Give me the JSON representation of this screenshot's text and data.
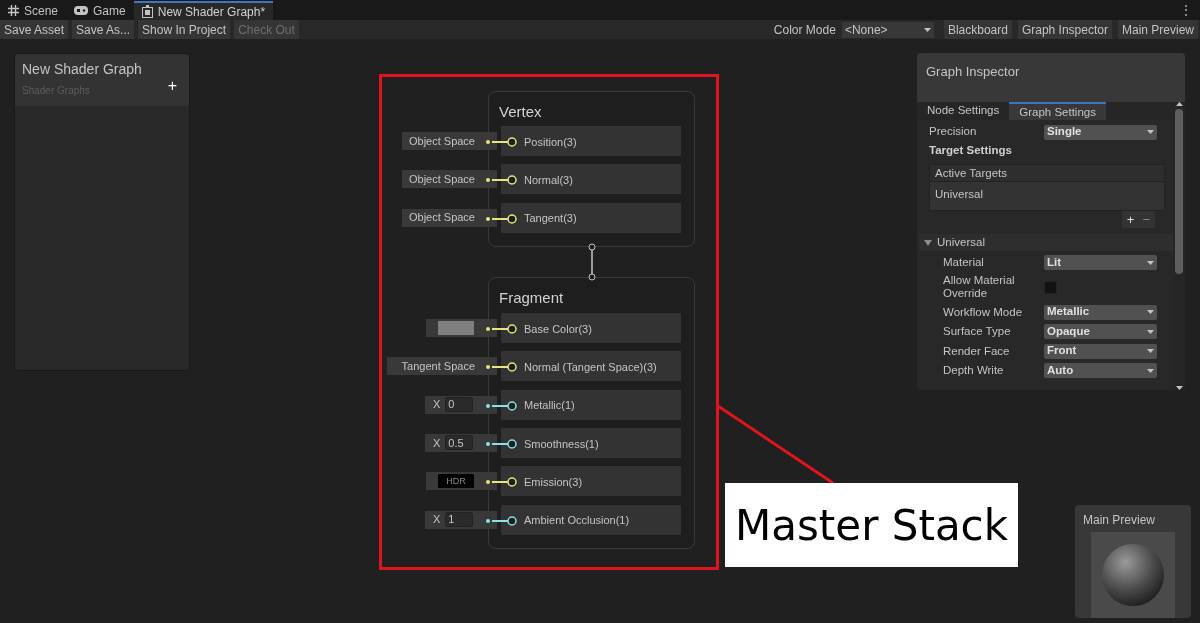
{
  "tabs": [
    {
      "label": "Scene",
      "kind": "scene",
      "selected": false
    },
    {
      "label": "Game",
      "kind": "game",
      "selected": false
    },
    {
      "label": "New Shader Graph*",
      "kind": "shader_graph",
      "selected": true
    }
  ],
  "more_menu": "⋮",
  "toolbar": {
    "left_buttons": [
      {
        "label": "Save Asset",
        "disabled": false
      },
      {
        "label": "Save As...",
        "disabled": false
      },
      {
        "label": "Show In Project",
        "disabled": false
      },
      {
        "label": "Check Out",
        "disabled": true
      }
    ],
    "color_mode": {
      "label": "Color Mode",
      "value": "<None>"
    },
    "right_buttons": [
      "Blackboard",
      "Graph Inspector",
      "Main Preview"
    ]
  },
  "blackboard": {
    "title": "New Shader Graph",
    "subtitle": "Shader Graphs",
    "add": "+"
  },
  "master_stack": {
    "blocks": [
      {
        "title": "Vertex",
        "ports": [
          {
            "name": "Position(3)",
            "color": "#e6e67a",
            "input": {
              "kind": "dropdown",
              "text": "Object Space"
            }
          },
          {
            "name": "Normal(3)",
            "color": "#e6e67a",
            "input": {
              "kind": "dropdown",
              "text": "Object Space"
            }
          },
          {
            "name": "Tangent(3)",
            "color": "#e6e67a",
            "input": {
              "kind": "dropdown",
              "text": "Object Space"
            }
          }
        ]
      },
      {
        "title": "Fragment",
        "ports": [
          {
            "name": "Base Color(3)",
            "color": "#e6e67a",
            "input": {
              "kind": "color"
            }
          },
          {
            "name": "Normal (Tangent Space)(3)",
            "color": "#e6e67a",
            "input": {
              "kind": "dropdown",
              "text": "Tangent Space"
            }
          },
          {
            "name": "Metallic(1)",
            "color": "#84e4e7",
            "input": {
              "kind": "float",
              "axis": "X",
              "text": "0"
            }
          },
          {
            "name": "Smoothness(1)",
            "color": "#84e4e7",
            "input": {
              "kind": "float",
              "axis": "X",
              "text": "0.5"
            }
          },
          {
            "name": "Emission(3)",
            "color": "#e6e67a",
            "input": {
              "kind": "hdr",
              "text": "HDR"
            }
          },
          {
            "name": "Ambient Occlusion(1)",
            "color": "#84e4e7",
            "input": {
              "kind": "float",
              "axis": "X",
              "text": "1"
            }
          }
        ]
      }
    ]
  },
  "annotation": {
    "label": "Master Stack"
  },
  "inspector": {
    "title": "Graph Inspector",
    "tabs": [
      {
        "label": "Node Settings",
        "selected": false
      },
      {
        "label": "Graph Settings",
        "selected": true
      }
    ],
    "precision": {
      "label": "Precision",
      "value": "Single"
    },
    "target_heading": "Target Settings",
    "active_targets": {
      "header": "Active Targets",
      "items": [
        "Universal"
      ],
      "add": "+",
      "remove": "−"
    },
    "section": {
      "title": "Universal",
      "expanded": true,
      "fields": [
        {
          "kind": "dropdown",
          "label": "Material",
          "value": "Lit"
        },
        {
          "kind": "checkbox",
          "label": "Allow Material Override",
          "checked": false
        },
        {
          "kind": "dropdown",
          "label": "Workflow Mode",
          "value": "Metallic"
        },
        {
          "kind": "dropdown",
          "label": "Surface Type",
          "value": "Opaque"
        },
        {
          "kind": "dropdown",
          "label": "Render Face",
          "value": "Front"
        },
        {
          "kind": "dropdown",
          "label": "Depth Write",
          "value": "Auto"
        }
      ]
    }
  },
  "main_preview": {
    "title": "Main Preview"
  }
}
